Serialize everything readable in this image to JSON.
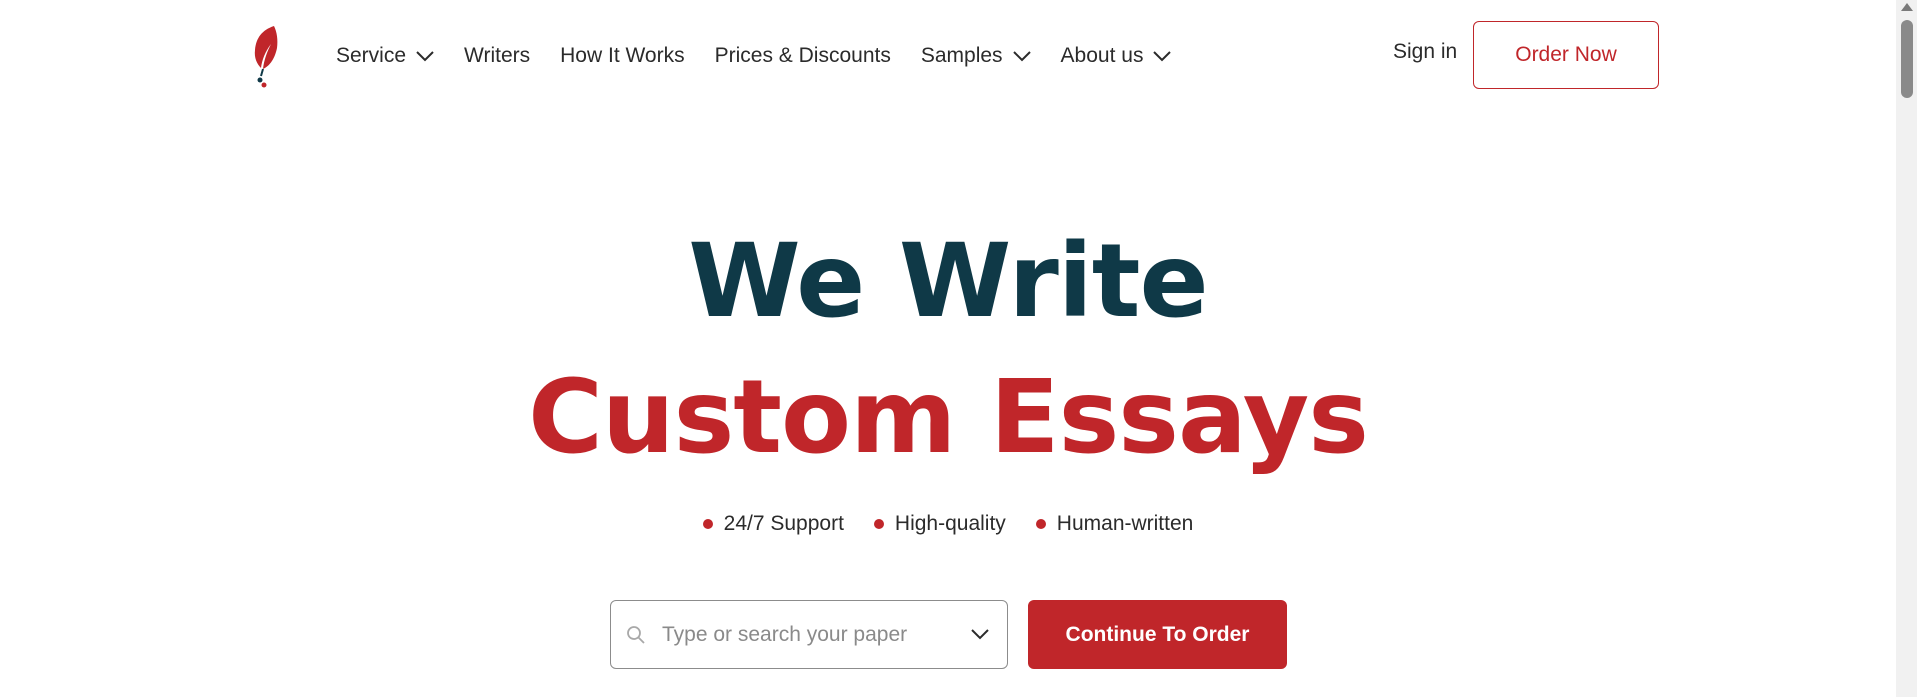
{
  "header": {
    "logo_icon": "quill-feather-icon",
    "nav": [
      {
        "label": "Service",
        "has_dropdown": true
      },
      {
        "label": "Writers",
        "has_dropdown": false
      },
      {
        "label": "How It Works",
        "has_dropdown": false
      },
      {
        "label": "Prices & Discounts",
        "has_dropdown": false
      },
      {
        "label": "Samples",
        "has_dropdown": true
      },
      {
        "label": "About us",
        "has_dropdown": true
      }
    ],
    "sign_in": "Sign in",
    "order_now": "Order Now"
  },
  "hero": {
    "line1": "We Write",
    "line2": "Custom Essays",
    "features": [
      "24/7 Support",
      "High-quality",
      "Human-written"
    ]
  },
  "search": {
    "placeholder": "Type or search your paper",
    "value": ""
  },
  "cta": {
    "continue_label": "Continue To Order"
  },
  "colors": {
    "brand_red": "#c0262a",
    "heading_dark": "#0f3947"
  }
}
